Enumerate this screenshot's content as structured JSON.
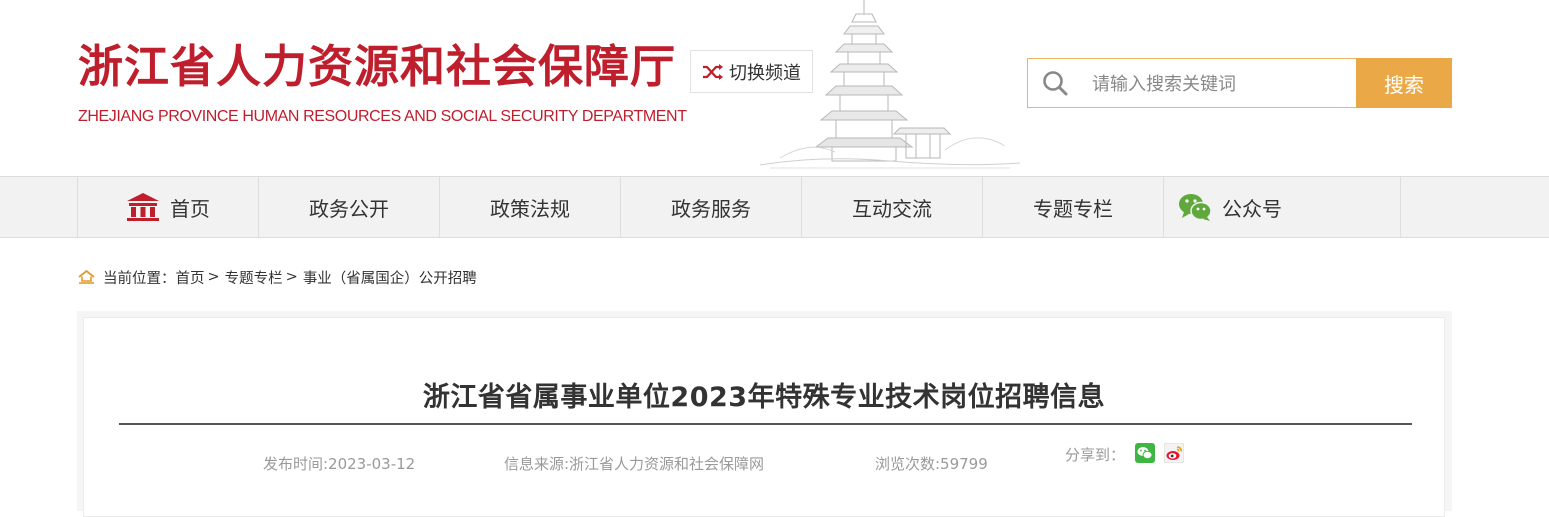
{
  "header": {
    "logo_cn": "浙江省人力资源和社会保障厅",
    "logo_en": "ZHEJIANG PROVINCE HUMAN RESOURCES AND SOCIAL SECURITY DEPARTMENT",
    "switch_channel_label": "切换频道",
    "search": {
      "placeholder": "请输入搜索关键词",
      "button_label": "搜索"
    }
  },
  "nav": {
    "items": [
      {
        "label": "首页",
        "icon": "home-building-icon"
      },
      {
        "label": "政务公开"
      },
      {
        "label": "政策法规"
      },
      {
        "label": "政务服务"
      },
      {
        "label": "互动交流"
      },
      {
        "label": "专题专栏"
      },
      {
        "label": "公众号",
        "icon": "wechat-icon"
      }
    ]
  },
  "breadcrumb": {
    "prefix": "当前位置：",
    "items": [
      "首页",
      "专题专栏",
      "事业（省属国企）公开招聘"
    ],
    "separator": ">"
  },
  "article": {
    "title": "浙江省省属事业单位2023年特殊专业技术岗位招聘信息",
    "publish_time": "发布时间:2023-03-12",
    "source": "信息来源:浙江省人力资源和社会保障网",
    "views": "浏览次数:59799",
    "share_label": "分享到：",
    "share_icons": [
      "wechat-share-icon",
      "weibo-share-icon"
    ]
  },
  "colors": {
    "brand_red": "#bf1e2d",
    "accent_orange": "#eaa946",
    "nav_bg": "#f2f2f2"
  }
}
